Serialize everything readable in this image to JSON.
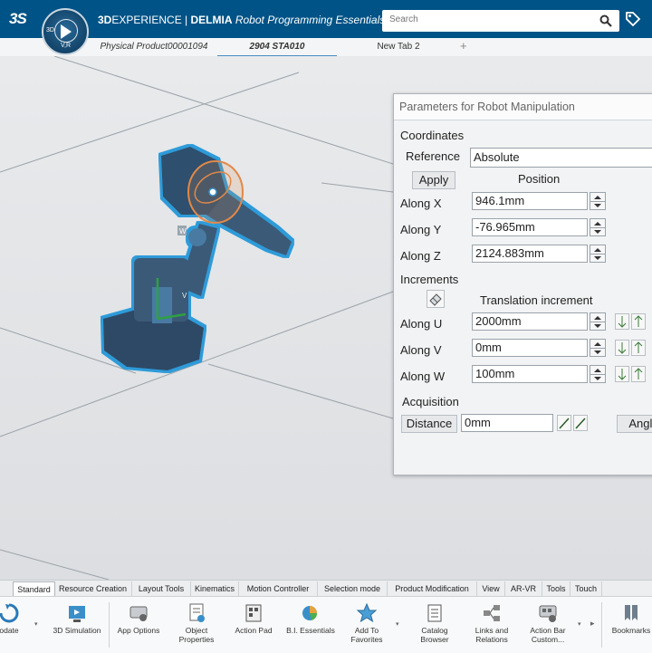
{
  "header": {
    "brand_bold": "3D",
    "brand_light": "EXPERIENCE",
    "separator": " | ",
    "brand2": "DELMIA",
    "app_name": "Robot Programming Essentials",
    "compass_top": "3D",
    "compass_bottom": "V,R",
    "search_placeholder": "Search"
  },
  "tabs": [
    {
      "label": "Physical Product00001094"
    },
    {
      "label": "2904 STA010"
    },
    {
      "label": "New Tab 2"
    }
  ],
  "tab_plus": "+",
  "dialog": {
    "title": "Parameters for Robot Manipulation",
    "coordinates_label": "Coordinates",
    "reference_label": "Reference",
    "reference_value": "Absolute",
    "apply_button": "Apply",
    "position_header": "Position",
    "along_x_label": "Along X",
    "along_x_value": "946.1mm",
    "along_y_label": "Along Y",
    "along_y_value": "-76.965mm",
    "along_z_label": "Along Z",
    "along_z_value": "2124.883mm",
    "increments_label": "Increments",
    "translation_header": "Translation increment",
    "along_u_label": "Along U",
    "along_u_value": "2000mm",
    "along_v_label": "Along V",
    "along_v_value": "0mm",
    "along_w_label": "Along W",
    "along_w_value": "100mm",
    "acquisition_label": "Acquisition",
    "distance_button": "Distance",
    "distance_value": "0mm",
    "angle_button": "Angle"
  },
  "viewer": {
    "robot_label_w": "W",
    "robot_label_v": "V"
  },
  "section_tabs": [
    {
      "label": "Standard"
    },
    {
      "label": "Resource Creation"
    },
    {
      "label": "Layout Tools"
    },
    {
      "label": "Kinematics"
    },
    {
      "label": "Motion Controller"
    },
    {
      "label": "Selection mode"
    },
    {
      "label": "Product Modification"
    },
    {
      "label": "View"
    },
    {
      "label": "AR-VR"
    },
    {
      "label": "Tools"
    },
    {
      "label": "Touch"
    }
  ],
  "actions": [
    {
      "label": "odate",
      "icon": "update-icon"
    },
    {
      "label": "3D Simulation",
      "icon": "simulation-icon"
    },
    {
      "label": "App Options",
      "icon": "options-icon"
    },
    {
      "label": "Object Properties",
      "icon": "properties-icon"
    },
    {
      "label": "Action Pad",
      "icon": "action-pad-icon"
    },
    {
      "label": "B.I. Essentials",
      "icon": "bi-icon"
    },
    {
      "label": "Add To Favorites",
      "icon": "star-icon"
    },
    {
      "label": "Catalog Browser",
      "icon": "catalog-icon"
    },
    {
      "label": "Links and Relations",
      "icon": "links-icon"
    },
    {
      "label": "Action Bar Custom...",
      "icon": "action-bar-icon"
    },
    {
      "label": "Bookmarks",
      "icon": "bookmarks-icon"
    }
  ],
  "colors": {
    "banner": "#005386",
    "robot_highlight": "#2f9bd9",
    "robot_body": "#3a5a78",
    "manipulator_ring": "#e0894a"
  }
}
